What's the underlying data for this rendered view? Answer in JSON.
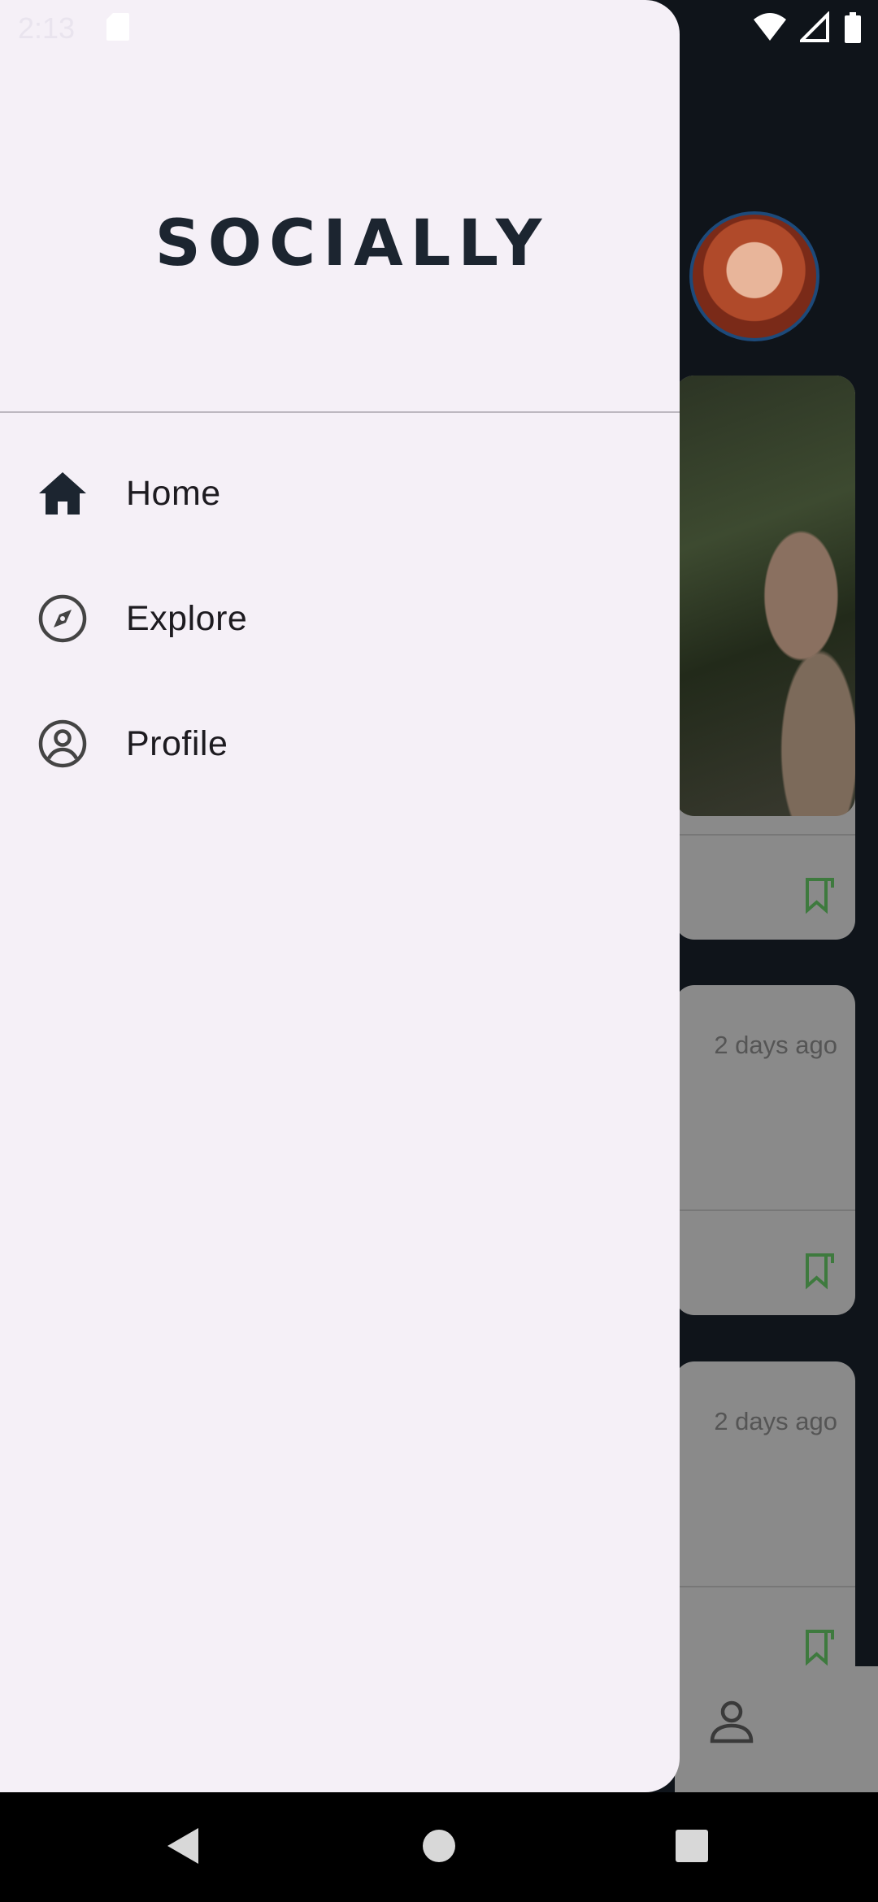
{
  "status_bar": {
    "time": "2:13",
    "icons": [
      "sd-card-icon",
      "wifi-icon",
      "signal-icon",
      "battery-icon"
    ]
  },
  "drawer": {
    "brand": "SOCIALLY",
    "items": [
      {
        "label": "Home",
        "icon": "home-icon"
      },
      {
        "label": "Explore",
        "icon": "compass-icon"
      },
      {
        "label": "Profile",
        "icon": "account-circle-icon"
      }
    ]
  },
  "background": {
    "posts": [
      {
        "time": ""
      },
      {
        "time": "2 days ago"
      },
      {
        "time": "2 days ago"
      }
    ]
  },
  "colors": {
    "drawer_bg": "#f5f0f7",
    "brand": "#1c2530",
    "scrim": "#0f141a",
    "bookmark": "#3e7a3e"
  },
  "nav_bar": {
    "buttons": [
      "back-icon",
      "home-circle-icon",
      "recents-icon"
    ]
  }
}
